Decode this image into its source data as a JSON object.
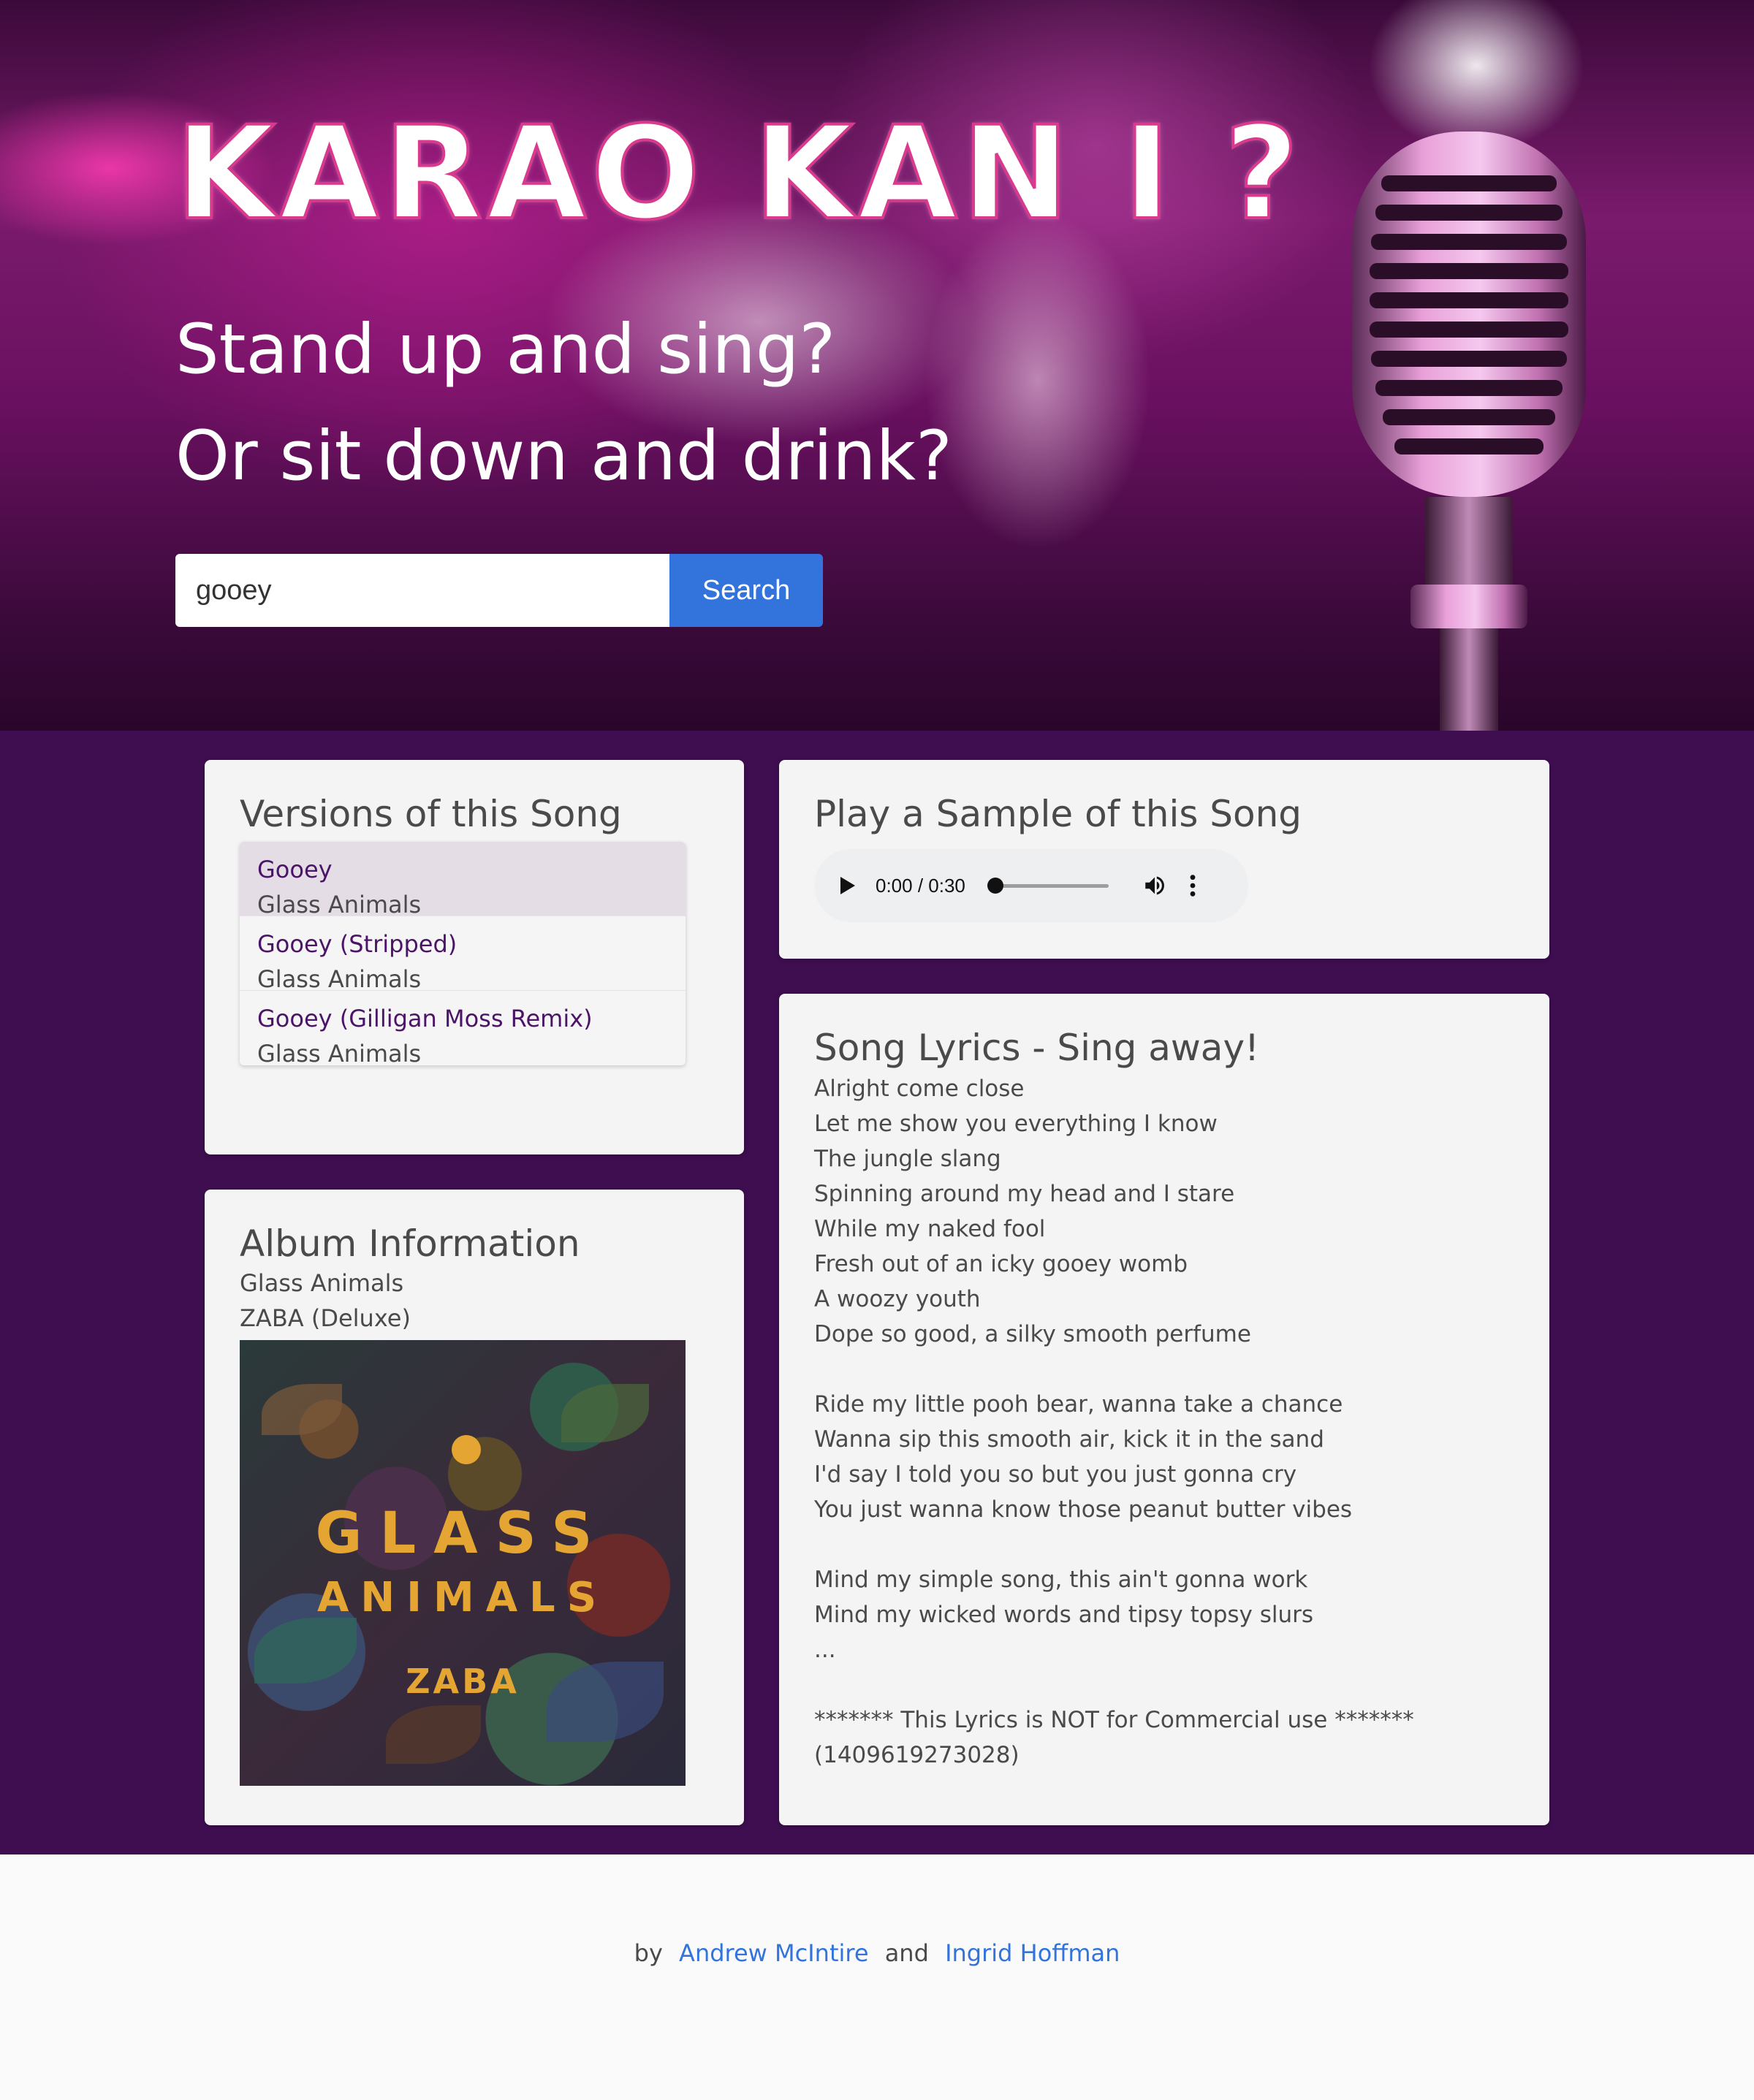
{
  "hero": {
    "brand": "KARAO KAN I ?",
    "tagline_line1": "Stand up and sing?",
    "tagline_line2": "Or sit down and drink?",
    "search_value": "gooey",
    "search_button": "Search"
  },
  "versions": {
    "heading": "Versions of this Song",
    "items": [
      {
        "title": "Gooey",
        "artist": "Glass Animals",
        "selected": true
      },
      {
        "title": "Gooey (Stripped)",
        "artist": "Glass Animals",
        "selected": false
      },
      {
        "title": "Gooey (Gilligan Moss Remix)",
        "artist": "Glass Animals",
        "selected": false
      }
    ]
  },
  "album": {
    "heading": "Album Information",
    "artist": "Glass Animals",
    "name": "ZABA (Deluxe)",
    "cover_text_line1": "GLASS",
    "cover_text_line2": "ANIMALS",
    "cover_text_line3": "ZABA"
  },
  "sample": {
    "heading": "Play a Sample of this Song",
    "time": "0:00 / 0:30",
    "progress": 0.0
  },
  "lyrics": {
    "heading": "Song Lyrics - Sing away!",
    "text": "Alright come close\nLet me show you everything I know\nThe jungle slang\nSpinning around my head and I stare\nWhile my naked fool\nFresh out of an icky gooey womb\nA woozy youth\nDope so good, a silky smooth perfume\n\nRide my little pooh bear, wanna take a chance\nWanna sip this smooth air, kick it in the sand\nI'd say I told you so but you just gonna cry\nYou just wanna know those peanut butter vibes\n\nMind my simple song, this ain't gonna work\nMind my wicked words and tipsy topsy slurs\n...\n\n******* This Lyrics is NOT for Commercial use *******\n(1409619273028)"
  },
  "footer": {
    "by": "by",
    "author1": "Andrew McIntire",
    "and": "and",
    "author2": "Ingrid Hoffman"
  },
  "colors": {
    "main_bg": "#3e0e50",
    "accent": "#3273dc",
    "link": "#3273dc",
    "version_title": "#4c1468"
  }
}
